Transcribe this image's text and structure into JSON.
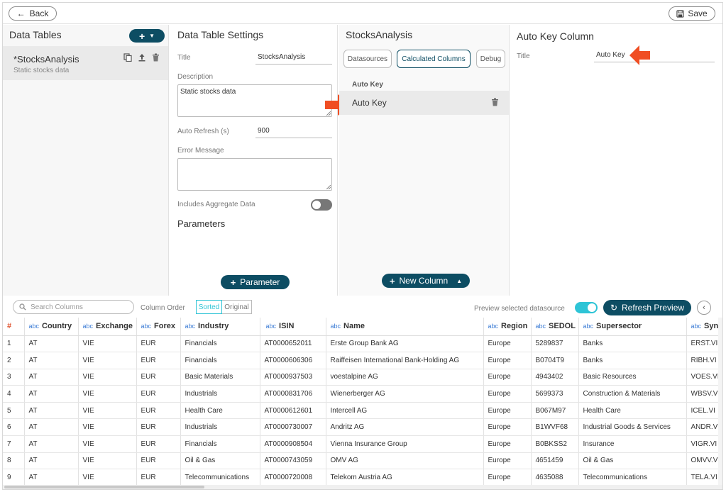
{
  "topbar": {
    "back_label": "Back",
    "save_label": "Save"
  },
  "data_tables": {
    "title": "Data Tables",
    "item": {
      "name": "*StocksAnalysis",
      "description": "Static stocks data"
    }
  },
  "settings": {
    "title": "Data Table Settings",
    "title_label": "Title",
    "title_value": "StocksAnalysis",
    "description_label": "Description",
    "description_value": "Static stocks data",
    "auto_refresh_label": "Auto Refresh (s)",
    "auto_refresh_value": "900",
    "error_label": "Error Message",
    "error_value": "",
    "aggregate_label": "Includes Aggregate Data",
    "aggregate_enabled": false,
    "parameters_title": "Parameters",
    "parameter_button": "Parameter"
  },
  "stocks_panel": {
    "title": "StocksAnalysis",
    "tabs": [
      "Datasources",
      "Calculated Columns",
      "Debug"
    ],
    "active_tab": "Calculated Columns",
    "section_header": "Auto Key",
    "row_label": "Auto Key",
    "new_column_button": "New Column"
  },
  "auto_key_panel": {
    "title": "Auto Key Column",
    "title_label": "Title",
    "title_value": "Auto Key"
  },
  "grid_toolbar": {
    "search_placeholder": "Search Columns",
    "column_order_label": "Column Order",
    "sorted_label": "Sorted",
    "original_label": "Original",
    "preview_label": "Preview selected datasource",
    "preview_enabled": true,
    "refresh_button": "Refresh Preview"
  },
  "grid": {
    "hash": "#",
    "type_tag": "abc",
    "columns": [
      "Country",
      "Exchange",
      "Forex",
      "Industry",
      "ISIN",
      "Name",
      "Region",
      "SEDOL",
      "Supersector",
      "Syn"
    ],
    "rows": [
      [
        "1",
        "AT",
        "VIE",
        "EUR",
        "Financials",
        "AT0000652011",
        "Erste Group Bank AG",
        "Europe",
        "5289837",
        "Banks",
        "ERST.VI"
      ],
      [
        "2",
        "AT",
        "VIE",
        "EUR",
        "Financials",
        "AT0000606306",
        "Raiffeisen International Bank-Holding AG",
        "Europe",
        "B0704T9",
        "Banks",
        "RIBH.VI"
      ],
      [
        "3",
        "AT",
        "VIE",
        "EUR",
        "Basic Materials",
        "AT0000937503",
        "voestalpine AG",
        "Europe",
        "4943402",
        "Basic Resources",
        "VOES.VI"
      ],
      [
        "4",
        "AT",
        "VIE",
        "EUR",
        "Industrials",
        "AT0000831706",
        "Wienerberger AG",
        "Europe",
        "5699373",
        "Construction & Materials",
        "WBSV.VI"
      ],
      [
        "5",
        "AT",
        "VIE",
        "EUR",
        "Health Care",
        "AT0000612601",
        "Intercell AG",
        "Europe",
        "B067M97",
        "Health Care",
        "ICEL.VI"
      ],
      [
        "6",
        "AT",
        "VIE",
        "EUR",
        "Industrials",
        "AT0000730007",
        "Andritz AG",
        "Europe",
        "B1WVF68",
        "Industrial Goods & Services",
        "ANDR.VI"
      ],
      [
        "7",
        "AT",
        "VIE",
        "EUR",
        "Financials",
        "AT0000908504",
        "Vienna Insurance Group",
        "Europe",
        "B0BKSS2",
        "Insurance",
        "VIGR.VI"
      ],
      [
        "8",
        "AT",
        "VIE",
        "EUR",
        "Oil & Gas",
        "AT0000743059",
        "OMV AG",
        "Europe",
        "4651459",
        "Oil & Gas",
        "OMVV.VI"
      ],
      [
        "9",
        "AT",
        "VIE",
        "EUR",
        "Telecommunications",
        "AT0000720008",
        "Telekom Austria AG",
        "Europe",
        "4635088",
        "Telecommunications",
        "TELA.VI"
      ]
    ]
  },
  "colors": {
    "primary": "#0d4d63",
    "accent_arrow": "#f04e23",
    "toggle_on": "#2ec4d6"
  }
}
